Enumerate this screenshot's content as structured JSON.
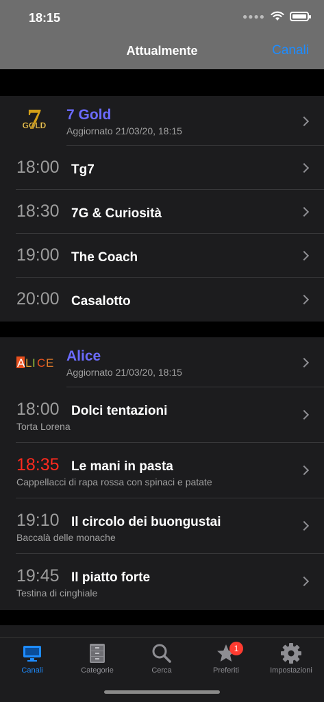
{
  "status_bar": {
    "time": "18:15"
  },
  "nav": {
    "title": "Attualmente",
    "right_button": "Canali"
  },
  "channels": [
    {
      "name": "7 Gold",
      "logo_text": "7",
      "logo_sub": "GOLD",
      "updated": "Aggiornato 21/03/20, 18:15",
      "programs": [
        {
          "time": "18:00",
          "title": "Tg7"
        },
        {
          "time": "18:30",
          "title": "7G & Curiosità"
        },
        {
          "time": "19:00",
          "title": "The Coach"
        },
        {
          "time": "20:00",
          "title": "Casalotto"
        }
      ]
    },
    {
      "name": "Alice",
      "logo_text": "ALICE",
      "updated": "Aggiornato 21/03/20, 18:15",
      "programs": [
        {
          "time": "18:00",
          "title": "Dolci tentazioni",
          "subtitle": "Torta Lorena"
        },
        {
          "time": "18:35",
          "title": "Le mani in pasta",
          "subtitle": "Cappellacci di rapa rossa con spinaci e patate",
          "live": true
        },
        {
          "time": "19:10",
          "title": "Il circolo dei buongustai",
          "subtitle": "Baccalà delle monache"
        },
        {
          "time": "19:45",
          "title": "Il piatto forte",
          "subtitle": "Testina di cinghiale"
        }
      ]
    }
  ],
  "tabs": [
    {
      "label": "Canali",
      "icon": "tv-icon",
      "active": true
    },
    {
      "label": "Categorie",
      "icon": "cabinet-icon"
    },
    {
      "label": "Cerca",
      "icon": "search-icon"
    },
    {
      "label": "Preferiti",
      "icon": "star-icon",
      "badge": "1"
    },
    {
      "label": "Impostazioni",
      "icon": "gear-icon"
    }
  ],
  "colors": {
    "accent": "#1e8cff",
    "channel_name": "#6b6bff",
    "live_time": "#ff2a1e",
    "badge": "#ff3b30"
  }
}
